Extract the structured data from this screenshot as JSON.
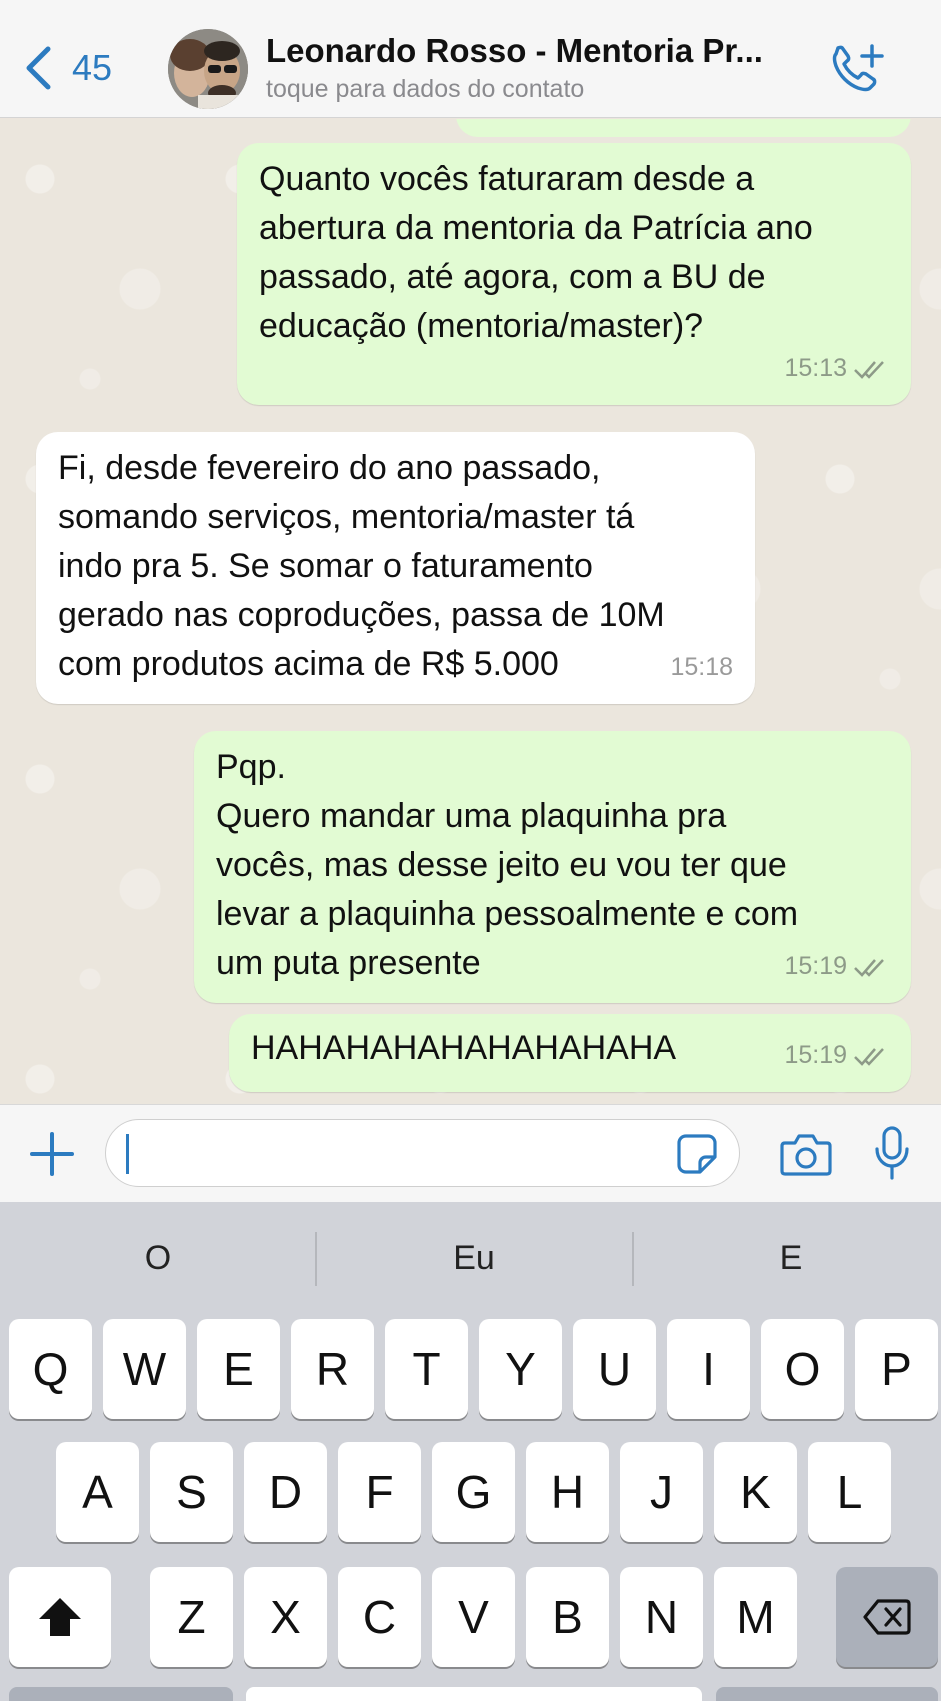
{
  "header": {
    "back_count": "45",
    "contact_name": "Leonardo Rosso - Mentoria Pr...",
    "contact_subtitle": "toque para dados do contato",
    "back_icon": "chevron-left-icon",
    "call_icon": "phone-plus-icon"
  },
  "messages": [
    {
      "direction": "outgoing",
      "text": "Quanto vocês faturaram desde a\nabertura da mentoria da Patrícia ano\npassado, até agora, com a BU de\neducação (mentoria/master)?",
      "time": "15:13",
      "status": "read"
    },
    {
      "direction": "incoming",
      "text": "Fi, desde fevereiro do ano passado,\nsomando serviços, mentoria/master tá\nindo pra 5. Se somar o faturamento\ngerado nas coproduções, passa de 10M\ncom produtos acima de R$ 5.000",
      "time": "15:18"
    },
    {
      "direction": "outgoing",
      "text": "Pqp.\nQuero mandar uma plaquinha pra\nvocês, mas desse jeito eu vou ter que\nlevar a plaquinha pessoalmente e com\num puta presente",
      "time": "15:19",
      "status": "read"
    },
    {
      "direction": "outgoing",
      "text": "HAHAHAHAHAHAHAHAHA",
      "time": "15:19",
      "status": "read"
    }
  ],
  "input": {
    "value": "",
    "icons": [
      "plus-icon",
      "sticker-icon",
      "camera-icon",
      "microphone-icon"
    ]
  },
  "keyboard": {
    "suggestions": [
      "O",
      "Eu",
      "E"
    ],
    "row1": [
      "Q",
      "W",
      "E",
      "R",
      "T",
      "Y",
      "U",
      "I",
      "O",
      "P"
    ],
    "row2": [
      "A",
      "S",
      "D",
      "F",
      "G",
      "H",
      "J",
      "K",
      "L"
    ],
    "row3": [
      "Z",
      "X",
      "C",
      "V",
      "B",
      "N",
      "M"
    ],
    "shift_icon": "shift-icon",
    "delete_icon": "backspace-icon"
  },
  "colors": {
    "accent": "#2c7bc0",
    "outgoing_bubble": "#e2fbd3",
    "incoming_bubble": "#ffffff",
    "chat_background": "#ebe6dd",
    "read_ticks": "#8d9a88"
  }
}
